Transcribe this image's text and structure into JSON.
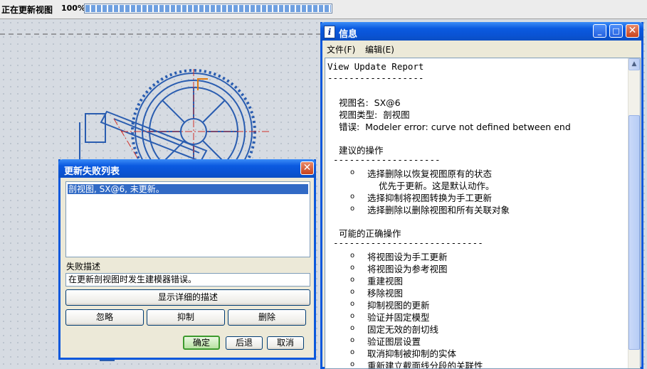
{
  "statusbar": {
    "text": "正在更新视图",
    "percent_label": "100%",
    "progress": 1.0
  },
  "info_window": {
    "title": "信息",
    "menu": [
      "文件(F)",
      "编辑(E)"
    ],
    "report": {
      "title": "View Update Report",
      "rule1": "------------------",
      "view_name": "视图名:  SX@6",
      "view_type": "视图类型:  剖视图",
      "error": "错误:  Modeler error: curve not defined between end",
      "suggest_heading": "建议的操作",
      "rule2": "--------------------",
      "suggest_items": [
        "选择删除以恢复视图原有的状态",
        "选择抑制将视图转换为手工更新",
        "选择删除以删除视图和所有关联对象"
      ],
      "suggest_note": "优先于更新。这是默认动作。",
      "correct_heading": "可能的正确操作",
      "rule3": "----------------------------",
      "correct_items": [
        "将视图设为手工更新",
        "将视图设为参考视图",
        "重建视图",
        "移除视图",
        "抑制视图的更新",
        "验证并固定模型",
        "固定无效的剖切线",
        "验证图层设置",
        "取消抑制被抑制的实体",
        "重新建立截面线分段的关联性"
      ]
    }
  },
  "fail_dialog": {
    "title": "更新失败列表",
    "list_items": [
      "剖视图, SX@6, 未更新。"
    ],
    "desc_label": "失败描述",
    "desc_value": "在更新剖视图时发生建模器错误。",
    "show_detail": "显示详细的描述",
    "ignore": "忽略",
    "suppress": "抑制",
    "delete": "删除",
    "ok": "确定",
    "back": "后退",
    "cancel": "取消"
  },
  "colors": {
    "title_bar": "#0a53d4",
    "drawing": "#2a5db0",
    "selection": "#316ac5"
  }
}
